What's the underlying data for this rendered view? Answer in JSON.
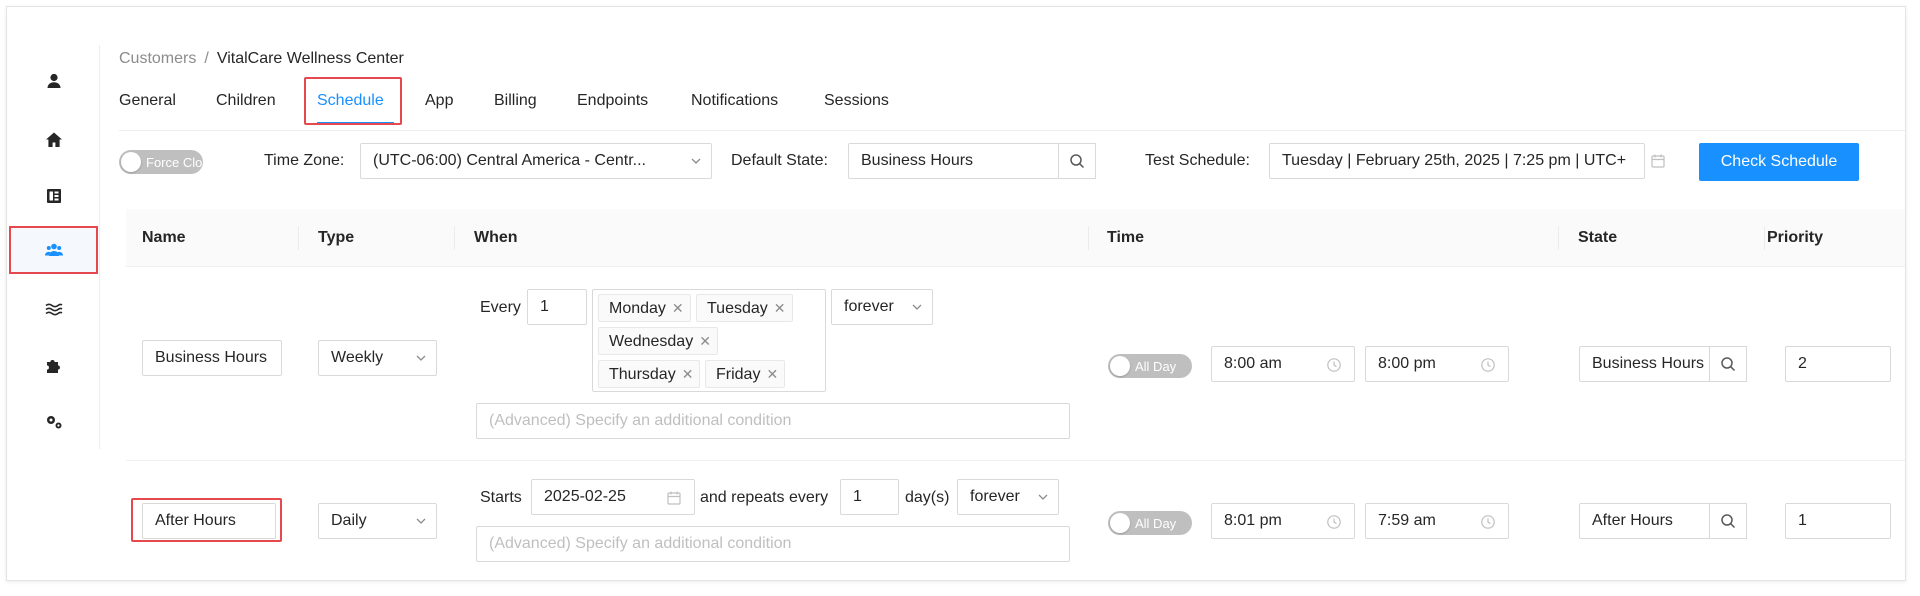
{
  "breadcrumb": {
    "parent": "Customers",
    "separator": "/",
    "current": "VitalCare Wellness Center"
  },
  "sidebar": {
    "items": [
      {
        "icon": "user-icon"
      },
      {
        "icon": "home-icon"
      },
      {
        "icon": "book-icon"
      },
      {
        "icon": "users-icon",
        "active": true
      },
      {
        "icon": "layers-icon"
      },
      {
        "icon": "puzzle-icon"
      },
      {
        "icon": "gears-icon"
      }
    ]
  },
  "tabs": [
    {
      "label": "General"
    },
    {
      "label": "Children"
    },
    {
      "label": "Schedule",
      "active": true
    },
    {
      "label": "App"
    },
    {
      "label": "Billing"
    },
    {
      "label": "Endpoints"
    },
    {
      "label": "Notifications"
    },
    {
      "label": "Sessions"
    }
  ],
  "toolbar": {
    "force_closed_label": "Force Closed",
    "time_zone_label": "Time Zone",
    "time_zone_value": "(UTC-06:00) Central America - Centr...",
    "default_state_label": "Default State",
    "default_state_value": "Business Hours",
    "test_schedule_label": "Test Schedule",
    "test_schedule_value": "Tuesday | February 25th, 2025 | 7:25 pm | UTC+",
    "check_schedule_label": "Check Schedule"
  },
  "table": {
    "headers": [
      "Name",
      "Type",
      "When",
      "Time",
      "State",
      "Priority"
    ],
    "rows": [
      {
        "name": "Business Hours",
        "type": "Weekly",
        "every_label": "Every",
        "every_value": "1",
        "days": [
          "Monday",
          "Tuesday",
          "Wednesday",
          "Thursday",
          "Friday"
        ],
        "repeat": "forever",
        "condition_placeholder": "(Advanced) Specify an additional condition",
        "all_day_label": "All Day",
        "start_time": "8:00 am",
        "end_time": "8:00 pm",
        "state": "Business Hours",
        "priority": "2"
      },
      {
        "name": "After Hours",
        "type": "Daily",
        "starts_label": "Starts",
        "start_date": "2025-02-25",
        "repeats_label": "and repeats every",
        "repeat_every": "1",
        "unit_label": "day(s)",
        "repeat": "forever",
        "condition_placeholder": "(Advanced) Specify an additional condition",
        "all_day_label": "All Day",
        "start_time": "8:01 pm",
        "end_time": "7:59 am",
        "state": "After Hours",
        "priority": "1"
      }
    ]
  },
  "colors": {
    "accent": "#1890ff",
    "highlight": "#e5484d"
  }
}
